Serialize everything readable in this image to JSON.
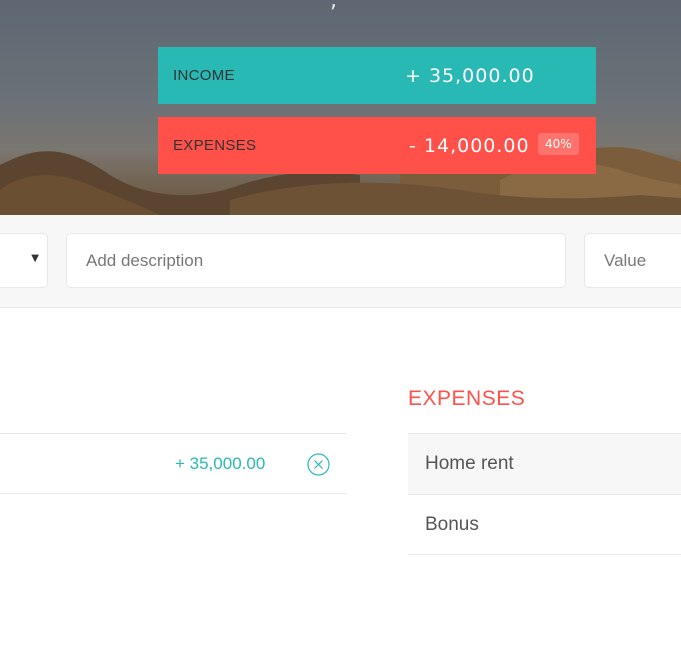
{
  "header": {
    "title_fragment": ","
  },
  "budget": {
    "income": {
      "label": "INCOME",
      "amount": "+ 35,000.00"
    },
    "expenses": {
      "label": "EXPENSES",
      "amount": "- 14,000.00",
      "percentage": "40%"
    }
  },
  "add_bar": {
    "type_select_icon": "chevron-down-icon",
    "description_placeholder": "Add description",
    "value_placeholder": "Value"
  },
  "income_list": {
    "items": [
      {
        "value": "+ 35,000.00",
        "delete_icon": "close-circle-icon"
      }
    ]
  },
  "expenses_list": {
    "title": "EXPENSES",
    "items": [
      {
        "description": "Home rent"
      },
      {
        "description": "Bonus"
      }
    ]
  },
  "colors": {
    "income": "#28b9b5",
    "expenses": "#ff5049",
    "bar_background": "#f7f7f7",
    "border": "#e7e7e7"
  }
}
